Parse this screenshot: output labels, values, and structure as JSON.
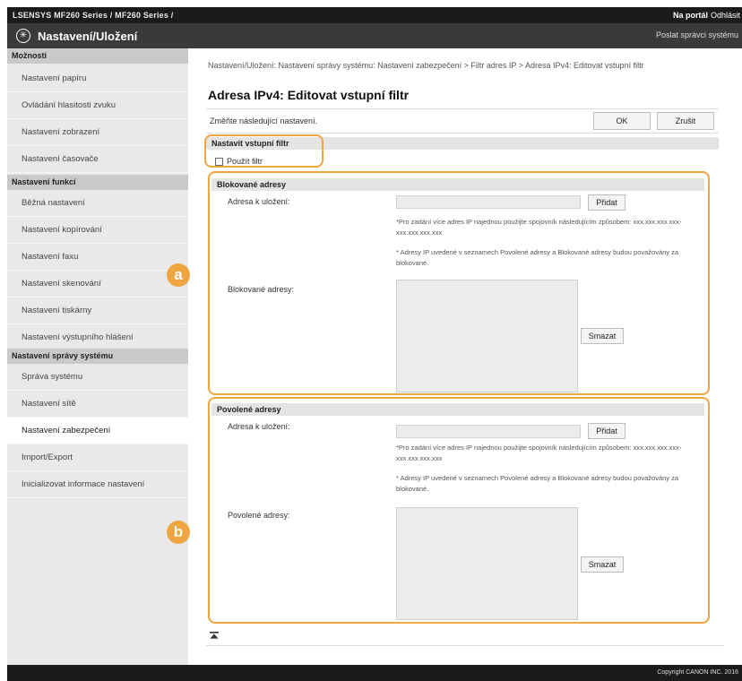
{
  "topbar": {
    "model": "LSENSYS     MF260 Series / MF260 Series /",
    "portal_label": "Na portál",
    "logout_label": "Odhlásit"
  },
  "header": {
    "title": "Nastavení/Uložení",
    "admin_link": "Poslat správci systému"
  },
  "sidebar": {
    "sections": [
      {
        "title": "Možnosti",
        "items": [
          "Nastavení papíru",
          "Ovládání hlasitosti zvuku",
          "Nastavení zobrazení",
          "Nastavení časovače"
        ]
      },
      {
        "title": "Nastavení funkcí",
        "items": [
          "Běžná nastavení",
          "Nastavení kopírování",
          "Nastavení faxu",
          "Nastavení skenování",
          "Nastavení tiskárny",
          "Nastavení výstupního hlášení"
        ]
      },
      {
        "title": "Nastavení správy systému",
        "items": [
          "Správa systému",
          "Nastavení sítě",
          "Nastavení zabezpečení",
          "Import/Export",
          "Inicializovat informace nastavení"
        ]
      }
    ],
    "active_item": "Nastavení zabezpečení"
  },
  "main": {
    "breadcrumb": "Nastavení/Uložení: Nastavení správy systému: Nastavení zabezpečení > Filtr adres IP > Adresa IPv4: Editovat vstupní filtr",
    "page_title": "Adresa IPv4: Editovat vstupní filtr",
    "instruction": "Změňte následující nastavení.",
    "ok_label": "OK",
    "cancel_label": "Zrušit",
    "input_filter": {
      "heading": "Nastavit vstupní filtr",
      "checkbox_label": "Použít filtr",
      "checked": false
    },
    "blocked": {
      "heading": "Blokované adresy",
      "address_label": "Adresa k uložení:",
      "address_value": "",
      "add_label": "Přidat",
      "note_range": "*Pro zadání více adres IP najednou použijte spojovník následujícím způsobem: xxx.xxx.xxx.xxx-xxx.xxx.xxx.xxx",
      "note_conflict": "* Adresy IP uvedené v seznamech Povolené adresy a Blokované adresy budou považovány za blokované.",
      "list_label": "Blokované adresy:",
      "delete_label": "Smazat",
      "badge": "a"
    },
    "allowed": {
      "heading": "Povolené adresy",
      "address_label": "Adresa k uložení:",
      "address_value": "",
      "add_label": "Přidat",
      "note_range": "*Pro zadání více adres IP najednou použijte spojovník následujícím způsobem: xxx.xxx.xxx.xxx-xxx.xxx.xxx.xxx",
      "note_conflict": "* Adresy IP uvedené v seznamech Povolené adresy a Blokované adresy budou považovány za blokované.",
      "list_label": "Povolené adresy:",
      "delete_label": "Smazat",
      "badge": "b"
    },
    "top_link_icon": "scroll-to-top-icon"
  },
  "footer": {
    "copyright": "Copyright CANON INC. 2016"
  },
  "colors": {
    "highlight": "#f0a640",
    "topbar": "#1b1b1b",
    "titlebar": "#3a3a3a",
    "sidebar_bg": "#e9e9e9"
  }
}
